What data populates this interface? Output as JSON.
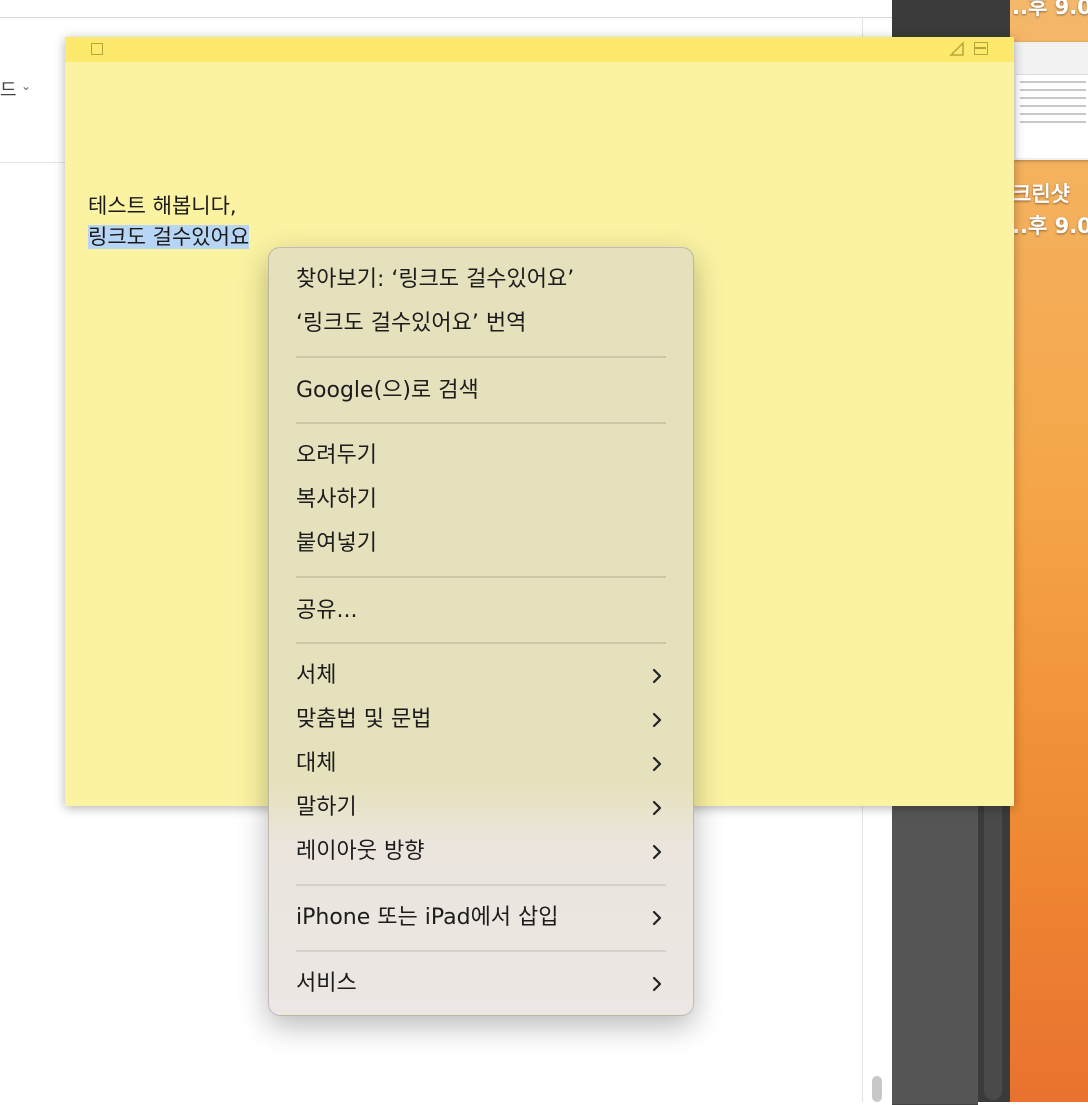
{
  "background_app": {
    "toolbar_label": "드",
    "chevron": "⌄"
  },
  "desktop": {
    "label_top": "..후 9.0",
    "screenshot_name": "크린샷",
    "screenshot_time": "..후 9.0"
  },
  "sticky_note": {
    "line1": "테스트 해봅니다,",
    "line2": "링크도 걸수있어요"
  },
  "context_menu": {
    "look_up": "찾아보기: ‘링크도 걸수있어요’",
    "translate": "‘링크도 걸수있어요’ 번역",
    "search_google": "Google(으)로 검색",
    "cut": "오려두기",
    "copy": "복사하기",
    "paste": "붙여넣기",
    "share": "공유...",
    "font": "서체",
    "spelling_grammar": "맞춤법 및 문법",
    "substitutions": "대체",
    "speech": "말하기",
    "layout_direction": "레이아웃 방향",
    "insert_from_iphone": "iPhone 또는 iPad에서 삽입",
    "services": "서비스"
  },
  "colors": {
    "note_yellow": "#fbf3a2",
    "note_titlebar": "#fde96c",
    "selection": "#b7d5f5"
  },
  "icons": [
    "close-box-icon",
    "resize-corner-icon",
    "collapse-icon",
    "chevron-right-icon",
    "chevron-down-icon"
  ]
}
